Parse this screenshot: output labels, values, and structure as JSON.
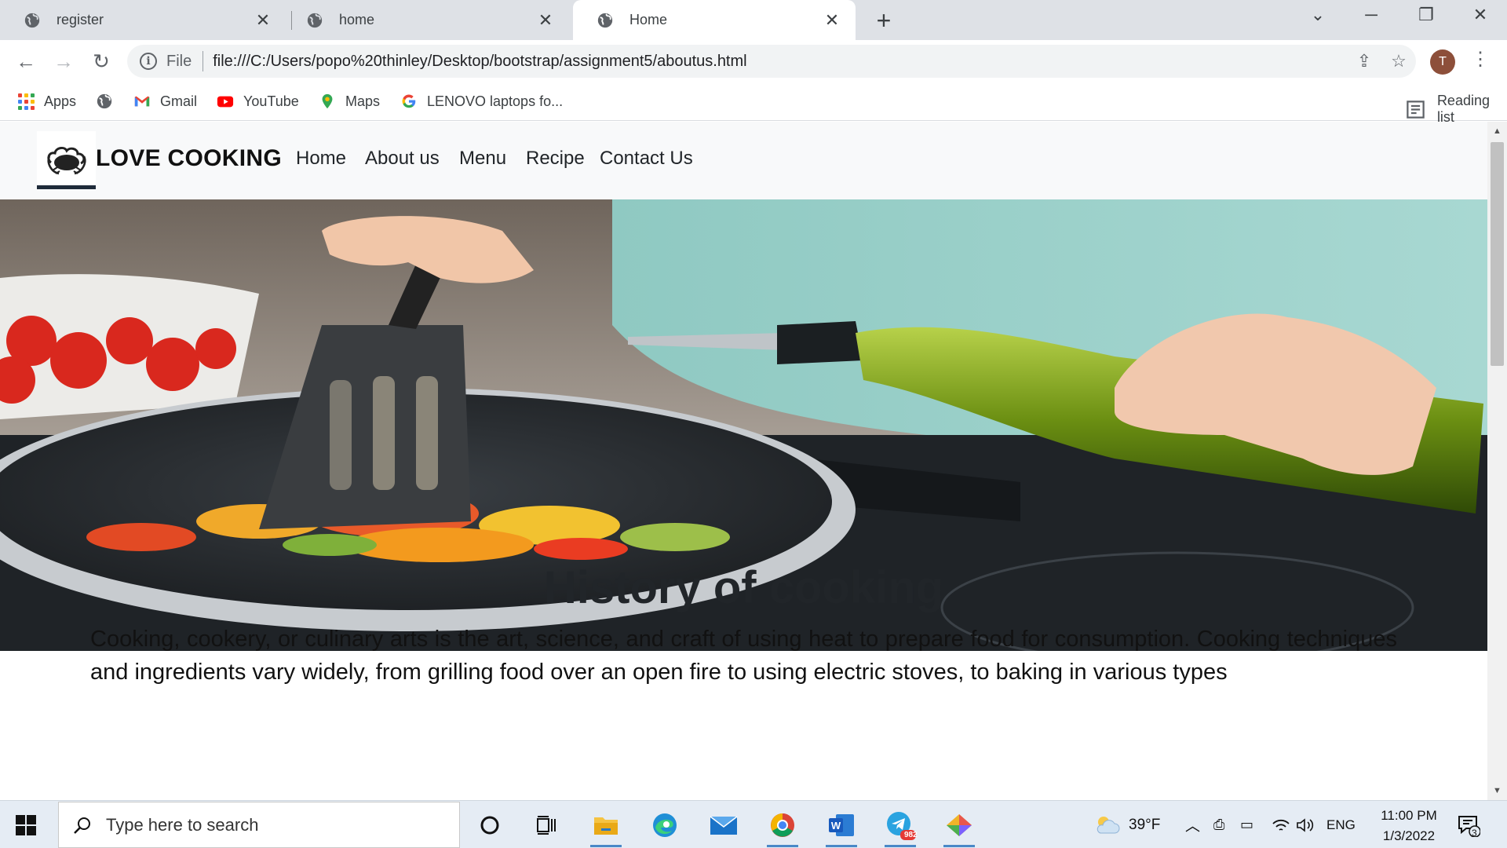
{
  "browser": {
    "tabs": [
      {
        "label": "register"
      },
      {
        "label": "home"
      },
      {
        "label": "Home"
      }
    ],
    "address": {
      "scheme_label": "File",
      "url": "file:///C:/Users/popo%20thinley/Desktop/bootstrap/assignment5/aboutus.html"
    },
    "profile_initial": "T",
    "bookmarks": {
      "apps": "Apps",
      "gmail": "Gmail",
      "youtube": "YouTube",
      "maps": "Maps",
      "lenovo": "LENOVO laptops fo...",
      "reading_list": "Reading list"
    }
  },
  "site": {
    "brand": "LOVE COOKING",
    "nav": [
      "Home",
      "About us",
      "Menu",
      "Recipe",
      "Contact Us"
    ],
    "history_title": "History of cooking",
    "history_text": "Cooking, cookery, or culinary arts is the art, science, and craft of using heat to prepare food for consumption. Cooking techniques and ingredients vary widely, from grilling food over an open fire to using electric stoves, to baking in various types"
  },
  "taskbar": {
    "search_placeholder": "Type here to search",
    "weather": "39°F",
    "language": "ENG",
    "time": "11:00 PM",
    "date": "1/3/2022",
    "telegram_badge": "982",
    "notification_count": "3"
  },
  "colors": {
    "tabstrip": "#dee1e6",
    "nav_bg": "#f8f9fa",
    "taskbar": "#e5ecf4"
  }
}
